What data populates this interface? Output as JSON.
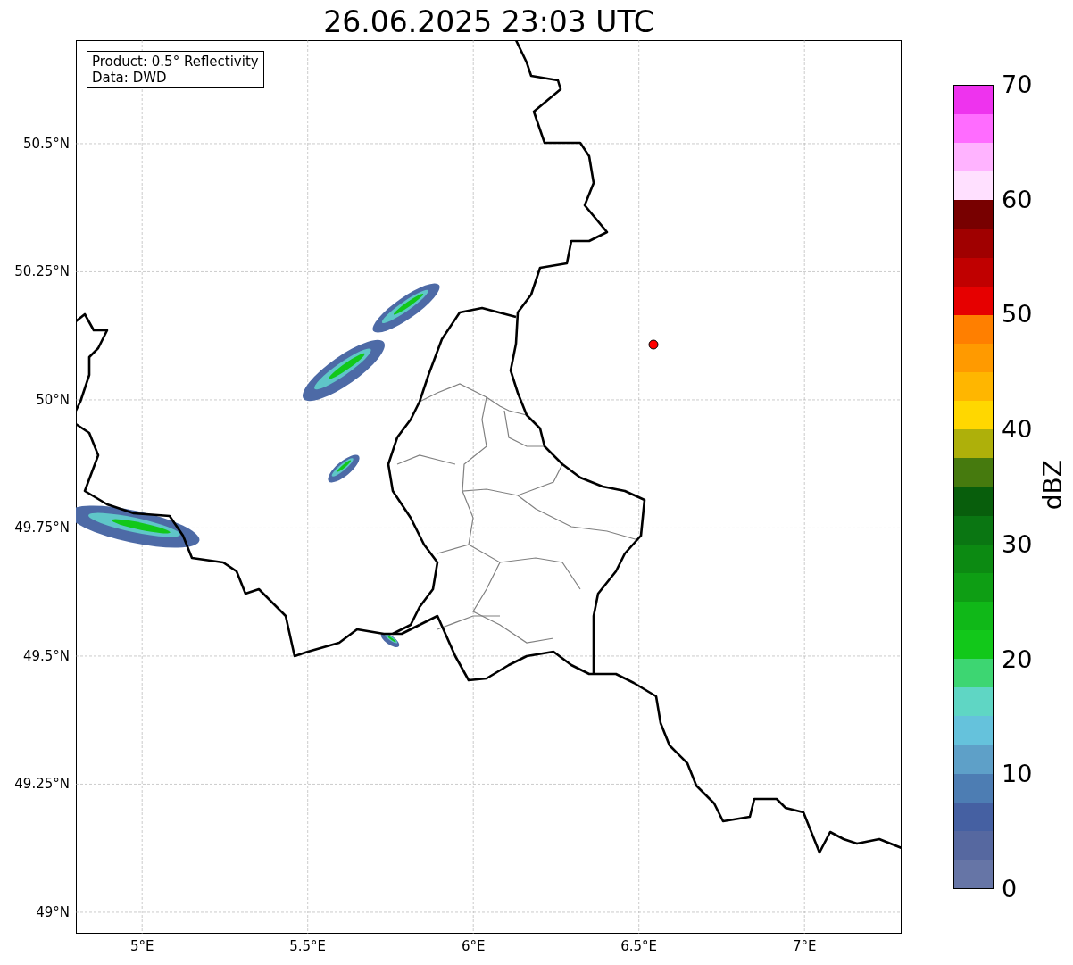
{
  "title": "26.06.2025 23:03 UTC",
  "info_box": [
    "Product: 0.5° Reflectivity",
    "Data: DWD"
  ],
  "map": {
    "lat_ticks": [
      "50.5°N",
      "50.25°N",
      "50°N",
      "49.75°N",
      "49.5°N",
      "49.25°N",
      "49°N"
    ],
    "lon_ticks": [
      "5°E",
      "5.5°E",
      "6°E",
      "6.5°E",
      "7°E"
    ]
  },
  "colorbar": {
    "label": "dBZ",
    "ticks": [
      "70",
      "60",
      "50",
      "40",
      "30",
      "20",
      "10",
      "0"
    ],
    "bands": [
      {
        "color": "#6675a6"
      },
      {
        "color": "#5668a0"
      },
      {
        "color": "#4560a2"
      },
      {
        "color": "#4d7db3"
      },
      {
        "color": "#5ea0c8"
      },
      {
        "color": "#65c2dc"
      },
      {
        "color": "#5fd6c4"
      },
      {
        "color": "#3dd672"
      },
      {
        "color": "#12c81a"
      },
      {
        "color": "#10b818"
      },
      {
        "color": "#0e9e14"
      },
      {
        "color": "#0c8a12"
      },
      {
        "color": "#0a7612"
      },
      {
        "color": "#085e0c"
      },
      {
        "color": "#467a0e"
      },
      {
        "color": "#aeb00a"
      },
      {
        "color": "#ffd700"
      },
      {
        "color": "#ffb600"
      },
      {
        "color": "#ff9a00"
      },
      {
        "color": "#ff7f00"
      },
      {
        "color": "#e60000"
      },
      {
        "color": "#c00000"
      },
      {
        "color": "#a00000"
      },
      {
        "color": "#780000"
      },
      {
        "color": "#ffe0ff"
      },
      {
        "color": "#ffb3ff"
      },
      {
        "color": "#ff6cff"
      },
      {
        "color": "#ee33ee"
      }
    ]
  }
}
